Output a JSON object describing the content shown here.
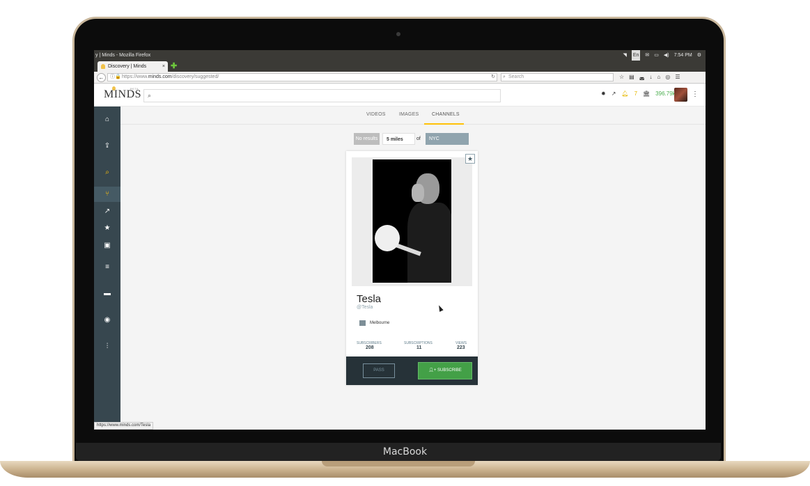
{
  "os": {
    "window_title": "y | Minds - Mozilla Firefox",
    "time": "7:54 PM",
    "lang": "En"
  },
  "browser": {
    "tab_title": "Discovery | Minds",
    "tab_close": "×",
    "new_tab": "✚",
    "url_prefix": "https://www.",
    "url_host": "minds.com",
    "url_path": "/discovery/suggested/",
    "search_placeholder": "Search",
    "status_url": "https://www.minds.com/Tesla"
  },
  "device": {
    "brand": "MacBook"
  },
  "app": {
    "logo": "MINDS",
    "logo_badge": "BETA",
    "notifications_count": "7",
    "points": "396.79k"
  },
  "tabs": [
    "VIDEOS",
    "IMAGES",
    "CHANNELS"
  ],
  "selected_tab": "CHANNELS",
  "filter": {
    "no_results": "No results",
    "distance": "5 miles",
    "of": "of",
    "city": "NYC"
  },
  "card": {
    "name": "Tesla",
    "handle": "@Tesla",
    "location": "Melbourne",
    "stats": [
      {
        "label": "SUBSCRIBERS",
        "value": "208"
      },
      {
        "label": "SUBSCRIPTIONS",
        "value": "11"
      },
      {
        "label": "VIEWS",
        "value": "223"
      }
    ],
    "pass_label": "PASS",
    "subscribe_label": "SUBSCRIBE"
  },
  "icons": {
    "sidebar": [
      "home-icon",
      "upload-icon",
      "search-icon",
      "suggested-icon",
      "trending-icon",
      "featured-icon",
      "subscriptions-icon",
      "newsfeed-icon",
      "messenger-icon",
      "groups-icon",
      "settings-icon"
    ],
    "topbar": [
      "bug-icon",
      "trending-icon",
      "bell-icon",
      "bank-icon"
    ]
  },
  "colors": {
    "accent": "#ffc107",
    "sidebar": "#37474f",
    "subscribe": "#43a047",
    "points": "#4caf50"
  }
}
